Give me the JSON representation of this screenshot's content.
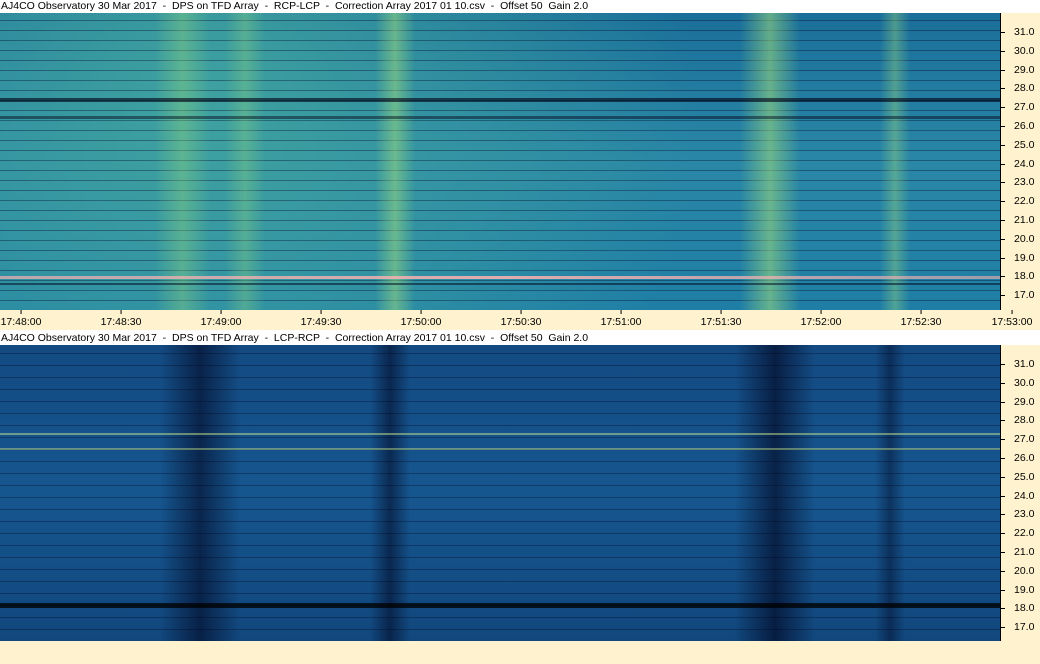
{
  "top_panel": {
    "title": "AJ4CO Observatory 30 Mar 2017  -  DPS on TFD Array  -  RCP-LCP  -  Correction Array 2017 01 10.csv  -  Offset 50  Gain 2.0"
  },
  "bottom_panel": {
    "title": "AJ4CO Observatory 30 Mar 2017  -  DPS on TFD Array  -  LCP-RCP  -  Correction Array 2017 01 10.csv  -  Offset 50  Gain 2.0"
  },
  "y_axis_labels": [
    "31.0",
    "30.0",
    "29.0",
    "28.0",
    "27.0",
    "26.0",
    "25.0",
    "24.0",
    "23.0",
    "22.0",
    "21.0",
    "20.0",
    "19.0",
    "18.0",
    "17.0"
  ],
  "x_axis_labels": [
    "17:48:00",
    "17:48:30",
    "17:49:00",
    "17:49:30",
    "17:50:00",
    "17:50:30",
    "17:51:00",
    "17:51:30",
    "17:52:00",
    "17:52:30",
    "17:53:00"
  ],
  "colors": {
    "axis_background": "#fff3cf",
    "spectrogram_top": "#1f7ea5",
    "spectrogram_bottom": "#134a82",
    "burst_band": "#9fe07a",
    "rfi_line": "#f4b0b0"
  }
}
